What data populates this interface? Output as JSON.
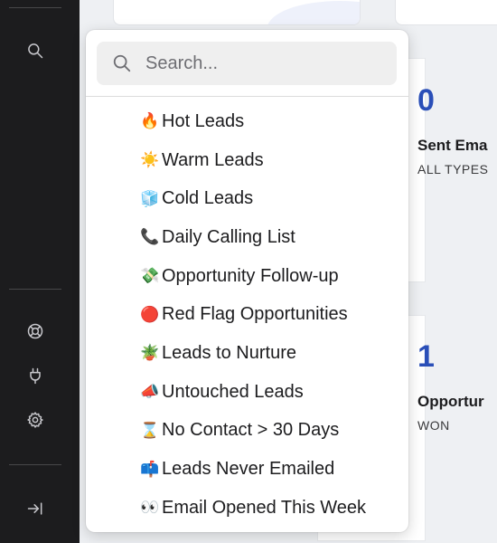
{
  "search": {
    "placeholder": "Search...",
    "value": ""
  },
  "saved_views": [
    {
      "emoji": "🔥",
      "label": "Hot Leads"
    },
    {
      "emoji": "☀️",
      "label": "Warm Leads"
    },
    {
      "emoji": "🧊",
      "label": "Cold Leads"
    },
    {
      "emoji": "📞",
      "label": "Daily Calling List"
    },
    {
      "emoji": "💸",
      "label": "Opportunity Follow-up"
    },
    {
      "emoji": "🔴",
      "label": "Red Flag Opportunities"
    },
    {
      "emoji": "🪴",
      "label": "Leads to Nurture"
    },
    {
      "emoji": "📣",
      "label": "Untouched Leads"
    },
    {
      "emoji": "⌛",
      "label": "No Contact > 30 Days"
    },
    {
      "emoji": "📫",
      "label": "Leads Never Emailed"
    },
    {
      "emoji": "👀",
      "label": "Email Opened This Week"
    }
  ],
  "stats": [
    {
      "value": "0",
      "title": "Sent Ema",
      "subtitle": "ALL TYPES"
    },
    {
      "value": "1",
      "title": "Opportur",
      "subtitle": "WON"
    }
  ],
  "sidebar": {
    "icons": [
      "search-icon",
      "help-lifebuoy-icon",
      "plug-icon",
      "gear-icon",
      "collapse-arrow-icon"
    ]
  },
  "colors": {
    "accent": "#2a4fb8",
    "sidebar_bg": "#1c1c1e"
  }
}
